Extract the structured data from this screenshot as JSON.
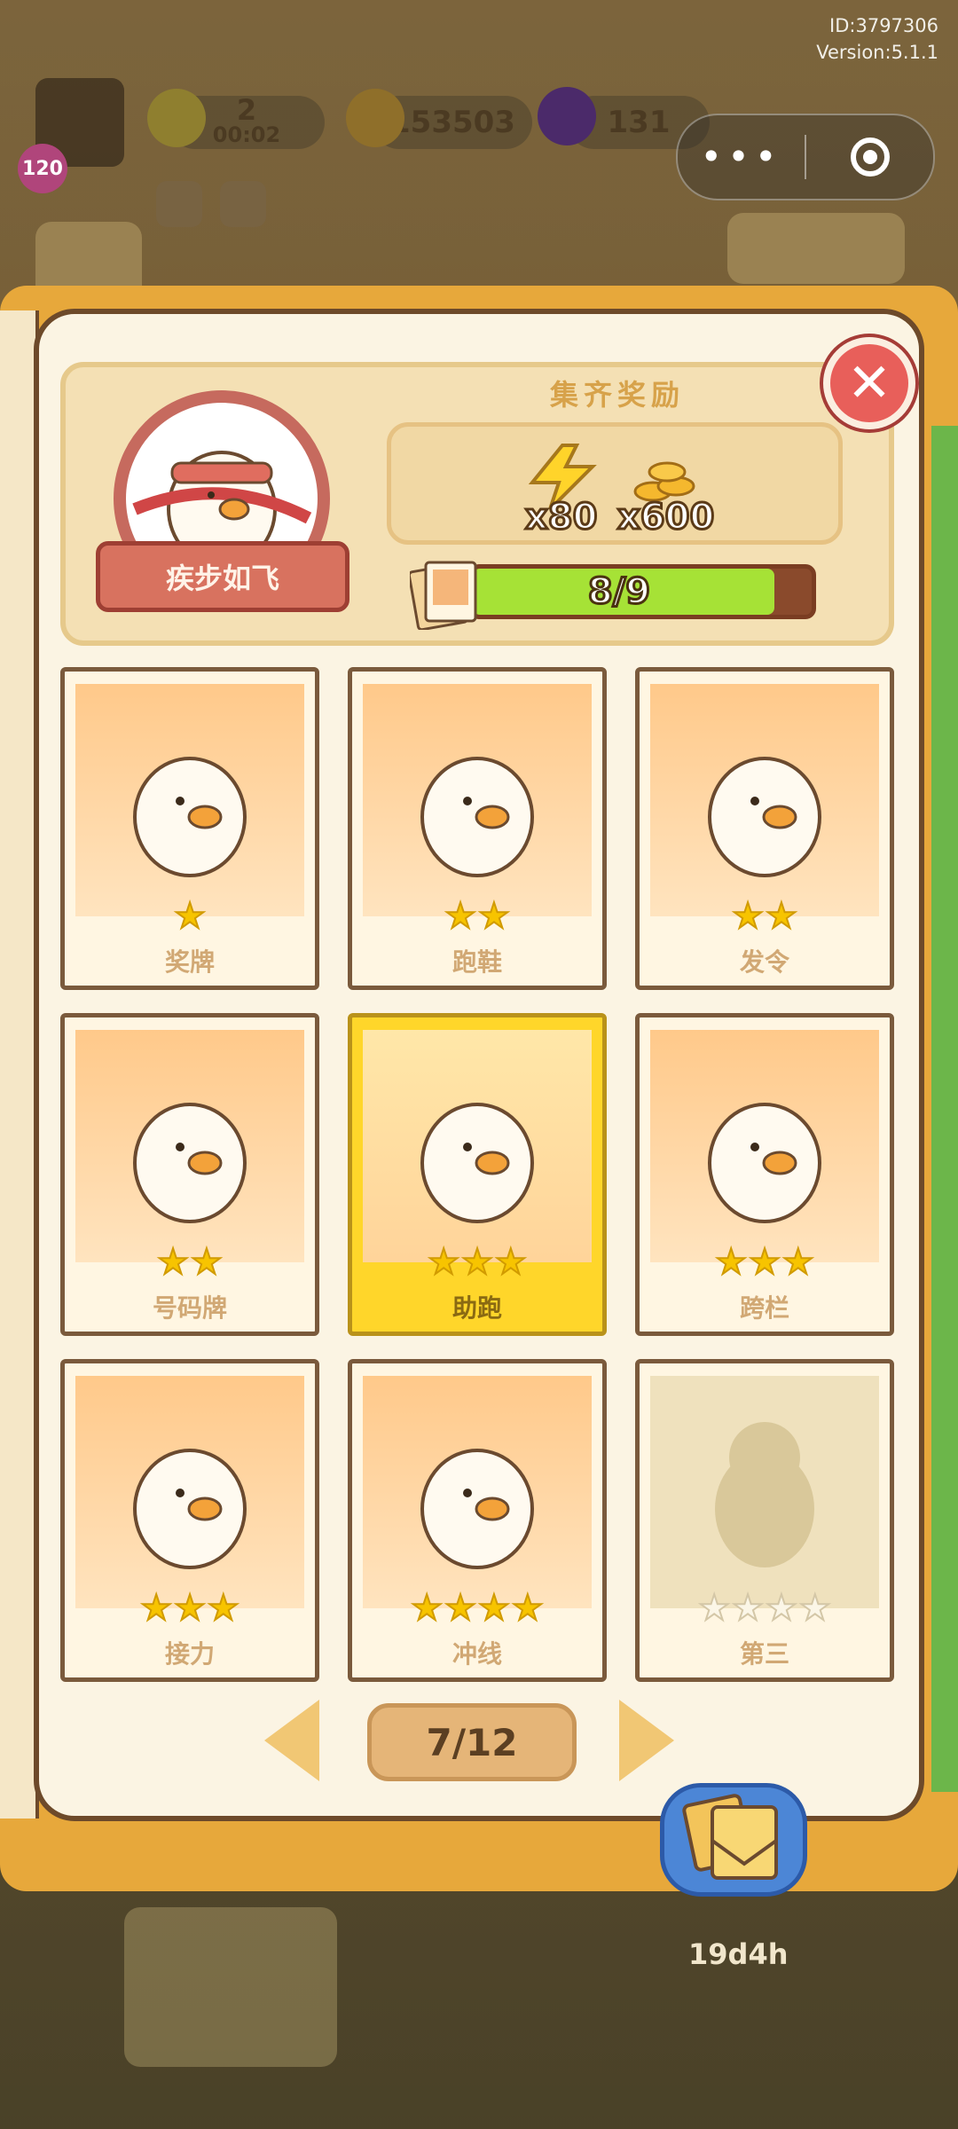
{
  "top_info": {
    "id": "ID:3797306",
    "version": "Version:5.1.1"
  },
  "hud": {
    "level": "120",
    "energy": "2",
    "energy_timer": "00:02",
    "coins": "153503",
    "gems": "131"
  },
  "set": {
    "name": "疾步如飞",
    "reward_title": "集齐奖励",
    "rewards": [
      {
        "icon": "lightning-icon",
        "label": "x80"
      },
      {
        "icon": "coin-stack-icon",
        "label": "x600"
      }
    ],
    "progress_text": "8/9",
    "progress_fraction": 0.889
  },
  "cards": [
    {
      "label": "奖牌",
      "stars": 1,
      "max_stars": 1,
      "collected": true,
      "active": false,
      "art": "medal-icon"
    },
    {
      "label": "跑鞋",
      "stars": 2,
      "max_stars": 2,
      "collected": true,
      "active": false,
      "art": "sneakers-icon"
    },
    {
      "label": "发令",
      "stars": 2,
      "max_stars": 2,
      "collected": true,
      "active": false,
      "art": "starter-pistol-icon"
    },
    {
      "label": "号码牌",
      "stars": 2,
      "max_stars": 2,
      "collected": true,
      "active": false,
      "art": "number-bib-icon"
    },
    {
      "label": "助跑",
      "stars": 3,
      "max_stars": 3,
      "collected": true,
      "active": true,
      "art": "run-up-icon"
    },
    {
      "label": "跨栏",
      "stars": 3,
      "max_stars": 3,
      "collected": true,
      "active": false,
      "art": "hurdle-icon"
    },
    {
      "label": "接力",
      "stars": 3,
      "max_stars": 3,
      "collected": true,
      "active": false,
      "art": "relay-baton-icon"
    },
    {
      "label": "冲线",
      "stars": 4,
      "max_stars": 4,
      "collected": true,
      "active": false,
      "art": "finish-line-icon"
    },
    {
      "label": "第三",
      "stars": 0,
      "max_stars": 4,
      "collected": false,
      "active": false,
      "art": "silhouette-icon"
    }
  ],
  "pager": {
    "text": "7/12"
  },
  "bottom": {
    "timer": "19d4h"
  },
  "colors": {
    "book_orange": "#e7a83b",
    "progress_green": "#a6e236",
    "close_red": "#e85f5a",
    "active_card": "#ffd62a",
    "star_yellow": "#f7c400"
  }
}
